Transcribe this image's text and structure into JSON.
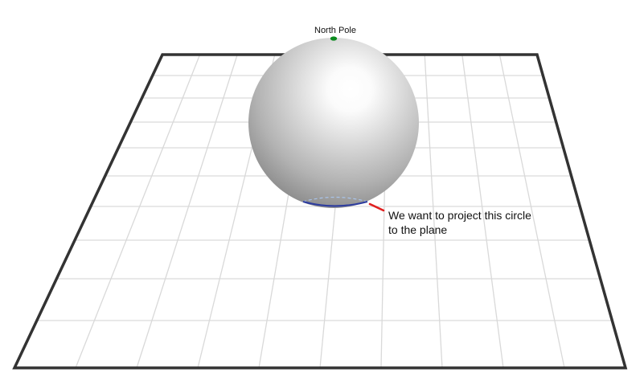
{
  "labels": {
    "north_pole": "North Pole",
    "annotation_line1": "We want to project this circle",
    "annotation_line2": "to the plane"
  },
  "colors": {
    "background": "#ffffff",
    "plane_border": "#333333",
    "grid_lines": "#d9d9d9",
    "sphere_highlight": "#ffffff",
    "sphere_shadow": "#8a8a8a",
    "north_pole_dot": "#0b8a1e",
    "projected_circle": "#2f3e9e",
    "circle_dashed_back": "#a9c4ea",
    "annotation_arrow": "#e02020",
    "text": "#111111"
  },
  "icons": {
    "north_pole_marker": "green-dot-icon",
    "annotation_pointer": "red-arrow-icon"
  }
}
